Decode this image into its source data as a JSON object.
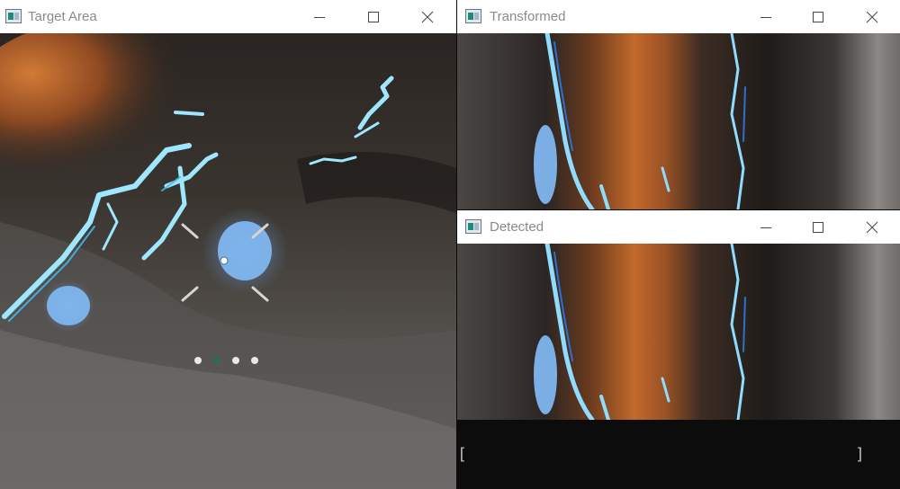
{
  "windows": {
    "target": {
      "title": "Target Area"
    },
    "transformed": {
      "title": "Transformed"
    },
    "detected": {
      "title": "Detected"
    }
  },
  "console": {
    "open_bracket": "[",
    "close_bracket": "]"
  },
  "icons": {
    "minimize": "minimize-icon",
    "maximize": "maximize-icon",
    "close": "close-icon",
    "app": "opencv-window-icon"
  }
}
